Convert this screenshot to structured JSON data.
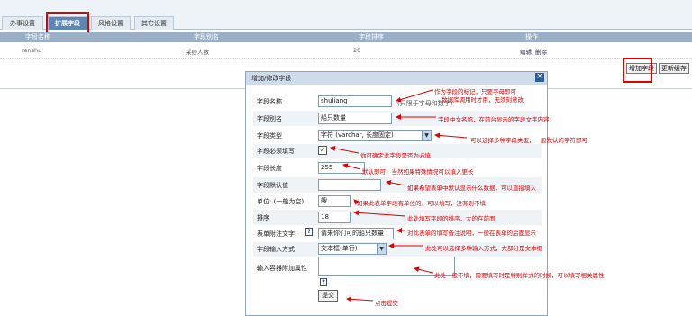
{
  "tabs": [
    {
      "label": "办事设置",
      "active": false
    },
    {
      "label": "扩展字段",
      "active": true
    },
    {
      "label": "风格设置",
      "active": false
    },
    {
      "label": "其它设置",
      "active": false
    }
  ],
  "table": {
    "headers": [
      "字段名称",
      "字段别名",
      "字段排序",
      "操作"
    ],
    "rows": [
      {
        "name": "renshu",
        "alias": "采纱人数",
        "order": "20",
        "edit": "编辑",
        "delete": "删除"
      }
    ]
  },
  "buttons": {
    "add_field": "增加字段",
    "update_cache": "更新缓存"
  },
  "dialog": {
    "title": "增加/修改字段",
    "close": "×",
    "fields": {
      "field_name": {
        "label": "字段名称",
        "value": "shuliang",
        "hint": "(只限于字母和数字)"
      },
      "field_alias": {
        "label": "字段别名",
        "value": "船只数量"
      },
      "field_type": {
        "label": "字段类型",
        "value": "字符 (varchar, 长度固定)"
      },
      "required": {
        "label": "字段必须填写",
        "checked": true
      },
      "length": {
        "label": "字段长度",
        "value": "255"
      },
      "default": {
        "label": "字段默认值",
        "value": ""
      },
      "unit": {
        "label": "单位: (一般为空)",
        "value": "艘"
      },
      "sort": {
        "label": "排序",
        "value": "18"
      },
      "note": {
        "label": "表单附注文字:",
        "value": "请来你们可的船只数量"
      },
      "input_mode": {
        "label": "字段输入方式",
        "value": "文本框(单行)"
      },
      "extra": {
        "label": "输入容器附加属性",
        "value": ""
      }
    },
    "help_icon": "?",
    "submit": "提交"
  },
  "annotations": [
    "作为字段的标记，只要字母即可",
    "数据库调用时才用，无须刻意改",
    "字段中文名称，在前台显示的字段文字内容",
    "可以选择多种字段类型，一般默认的字符即可",
    "你可确定此字段是否为必填",
    "默认即可，当然如果特殊情况可以填入更长",
    "如果希望表单中默认显示什么数据，可以直接填入",
    "如果此表单字段有单位的，可以填写，没有则不填",
    "此处填写字段的排序，大的在前面",
    "对此表单的填写备注说明，一般在表单的后面显示",
    "此处可以选择多种输入方式，大部分是文本框",
    "此处一般不填，需要填写时是特别样式的时候，可以填写相关属性",
    "点击提交"
  ],
  "colors": {
    "highlight": "#e00000",
    "annotation": "#e10000",
    "tab_active": "#5b87b8",
    "header_bg": "#9bb0c7",
    "dialog_title_bg": "#cddbeb"
  }
}
